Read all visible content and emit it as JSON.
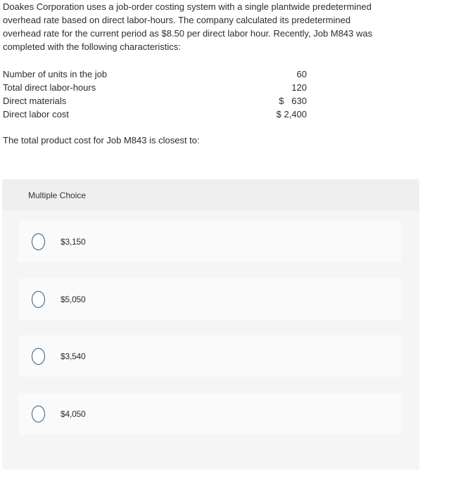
{
  "question": {
    "prompt_lines": [
      "Doakes Corporation uses a job-order costing system with a single plantwide predetermined",
      "overhead rate based on direct labor-hours. The company calculated its predetermined",
      "overhead rate for the current period as $8.50 per direct labor hour.  Recently, Job M843 was",
      "completed with the following characteristics:"
    ],
    "facts": [
      {
        "label": "Number of units in the job",
        "value": "60"
      },
      {
        "label": "Total direct labor-hours",
        "value": "120"
      },
      {
        "label": "Direct materials",
        "value": "$   630"
      },
      {
        "label": "Direct labor cost",
        "value": "$ 2,400"
      }
    ],
    "ask": "The total product cost for Job M843 is closest to:"
  },
  "multiple_choice": {
    "title": "Multiple Choice",
    "options": [
      {
        "label": "$3,150",
        "selected": false
      },
      {
        "label": "$5,050",
        "selected": false
      },
      {
        "label": "$3,540",
        "selected": false
      },
      {
        "label": "$4,050",
        "selected": false
      }
    ]
  },
  "colors": {
    "radio_border": "#2c5a85",
    "panel_bg": "#f5f5f5",
    "header_bg": "#efefef",
    "option_bg": "#fafafa"
  }
}
